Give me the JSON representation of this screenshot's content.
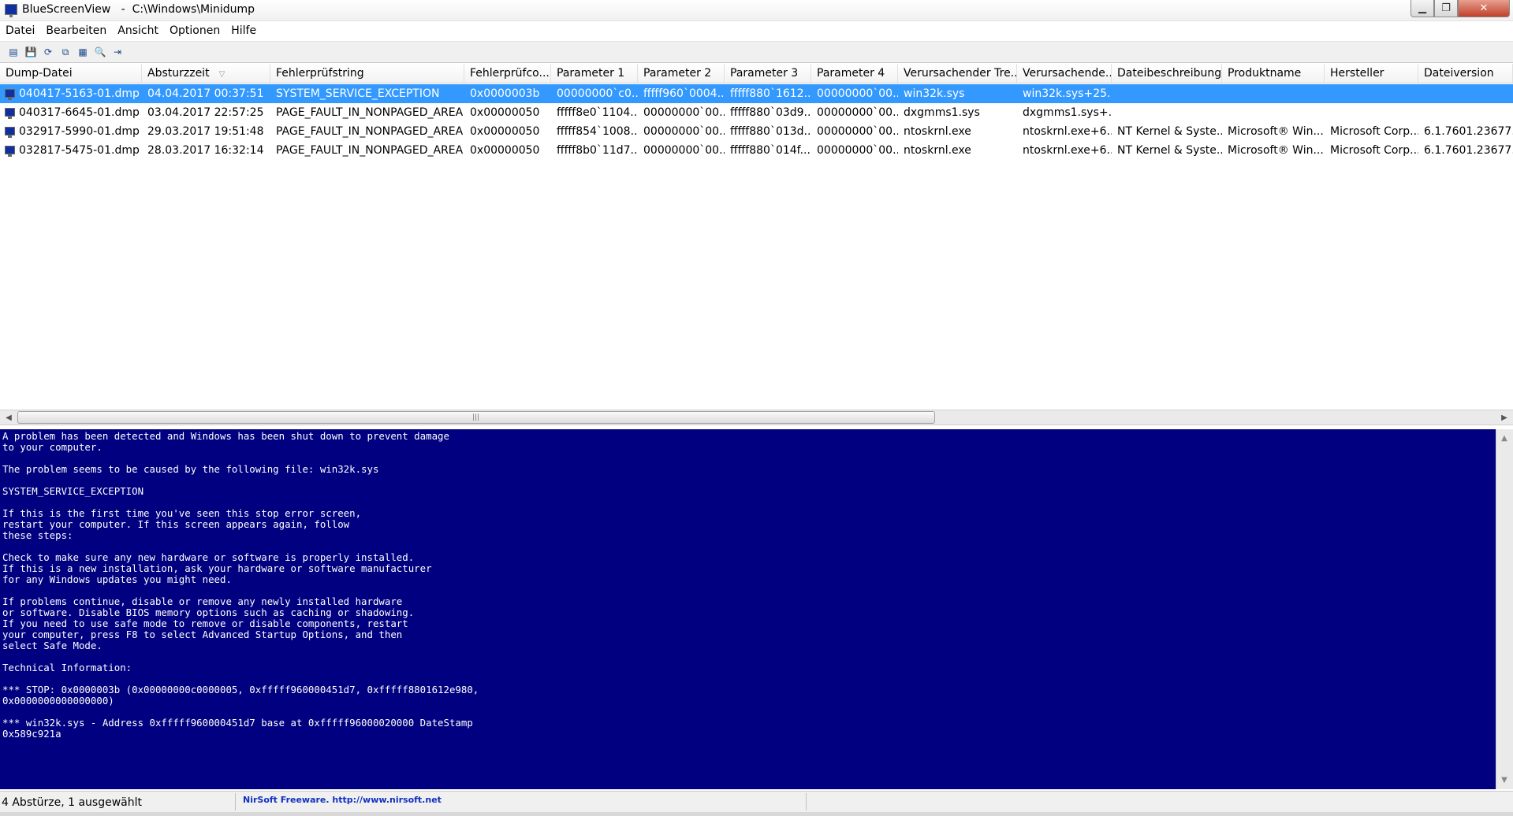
{
  "window": {
    "title": "BlueScreenView   -  C:\\Windows\\Minidump",
    "minimize_glyph": "▁",
    "maximize_glyph": "❐",
    "close_glyph": "✕"
  },
  "menu": [
    "Datei",
    "Bearbeiten",
    "Ansicht",
    "Optionen",
    "Hilfe"
  ],
  "toolbar": {
    "icons": [
      "html-report-icon",
      "save-icon",
      "refresh-icon",
      "copy-icon",
      "properties-icon",
      "find-icon",
      "exit-icon"
    ],
    "glyphs": [
      "▤",
      "💾",
      "⟳",
      "⧉",
      "▦",
      "🔍",
      "⇥"
    ]
  },
  "list": {
    "columns": [
      "Dump-Datei",
      "Absturzzeit",
      "Fehlerprüfstring",
      "Fehlerprüfco...",
      "Parameter 1",
      "Parameter 2",
      "Parameter 3",
      "Parameter 4",
      "Verursachender Tre...",
      "Verursachende...",
      "Dateibeschreibung",
      "Produktname",
      "Hersteller",
      "Dateiversion"
    ],
    "sort_arrow": "▽",
    "rows": [
      [
        "040417-5163-01.dmp",
        "04.04.2017 00:37:51",
        "SYSTEM_SERVICE_EXCEPTION",
        "0x0000003b",
        "00000000`c0...",
        "fffff960`0004...",
        "fffff880`1612...",
        "00000000`00...",
        "win32k.sys",
        "win32k.sys+25...",
        "",
        "",
        "",
        ""
      ],
      [
        "040317-6645-01.dmp",
        "03.04.2017 22:57:25",
        "PAGE_FAULT_IN_NONPAGED_AREA",
        "0x00000050",
        "fffff8e0`1104...",
        "00000000`00...",
        "fffff880`03d9...",
        "00000000`00...",
        "dxgmms1.sys",
        "dxgmms1.sys+...",
        "",
        "",
        "",
        ""
      ],
      [
        "032917-5990-01.dmp",
        "29.03.2017 19:51:48",
        "PAGE_FAULT_IN_NONPAGED_AREA",
        "0x00000050",
        "fffff854`1008...",
        "00000000`00...",
        "fffff880`013d...",
        "00000000`00...",
        "ntoskrnl.exe",
        "ntoskrnl.exe+6...",
        "NT Kernel & Syste...",
        "Microsoft® Win...",
        "Microsoft Corp...",
        "6.1.7601.23677..."
      ],
      [
        "032817-5475-01.dmp",
        "28.03.2017 16:32:14",
        "PAGE_FAULT_IN_NONPAGED_AREA",
        "0x00000050",
        "fffff8b0`11d7...",
        "00000000`00...",
        "fffff880`014f...",
        "00000000`00...",
        "ntoskrnl.exe",
        "ntoskrnl.exe+6...",
        "NT Kernel & Syste...",
        "Microsoft® Win...",
        "Microsoft Corp...",
        "6.1.7601.23677..."
      ]
    ],
    "selected_index": 0
  },
  "scrollbar": {
    "left_arrow": "◀",
    "right_arrow": "▶",
    "grip": "|||",
    "up_arrow": "▲",
    "down_arrow": "▼"
  },
  "bsod_text": "A problem has been detected and Windows has been shut down to prevent damage\nto your computer.\n\nThe problem seems to be caused by the following file: win32k.sys\n\nSYSTEM_SERVICE_EXCEPTION\n\nIf this is the first time you've seen this stop error screen,\nrestart your computer. If this screen appears again, follow\nthese steps:\n\nCheck to make sure any new hardware or software is properly installed.\nIf this is a new installation, ask your hardware or software manufacturer\nfor any Windows updates you might need.\n\nIf problems continue, disable or remove any newly installed hardware\nor software. Disable BIOS memory options such as caching or shadowing.\nIf you need to use safe mode to remove or disable components, restart\nyour computer, press F8 to select Advanced Startup Options, and then\nselect Safe Mode.\n\nTechnical Information:\n\n*** STOP: 0x0000003b (0x00000000c0000005, 0xfffff960000451d7, 0xfffff8801612e980,\n0x0000000000000000)\n\n*** win32k.sys - Address 0xfffff960000451d7 base at 0xfffff96000020000 DateStamp\n0x589c921a",
  "status": {
    "summary": "4 Abstürze, 1 ausgewählt",
    "link": "NirSoft Freeware.  http://www.nirsoft.net"
  },
  "colors": {
    "bsod_background": "#000080",
    "selection": "#3399ff",
    "link": "#1030c0"
  }
}
